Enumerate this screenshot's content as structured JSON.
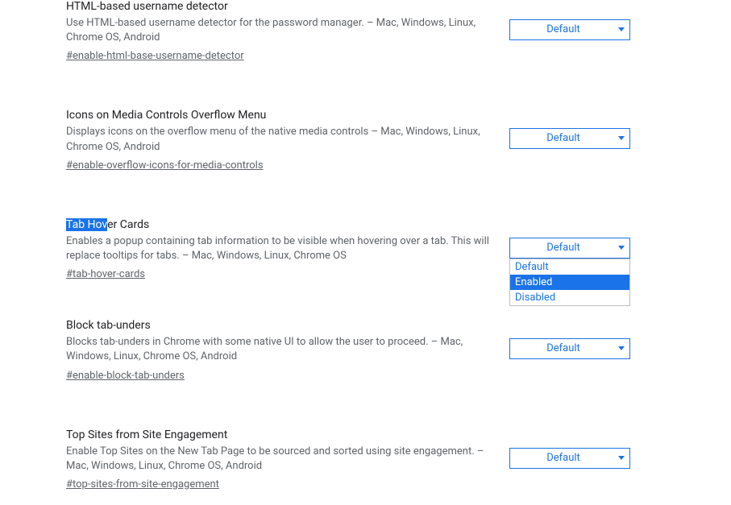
{
  "flags": [
    {
      "title": "HTML-based username detector",
      "desc": "Use HTML-based username detector for the password manager. – Mac, Windows, Linux, Chrome OS, Android",
      "hash": "#enable-html-base-username-detector",
      "highlight": null,
      "value": "Default",
      "open": false
    },
    {
      "title": "Icons on Media Controls Overflow Menu",
      "desc": "Displays icons on the overflow menu of the native media controls – Mac, Windows, Linux, Chrome OS, Android",
      "hash": "#enable-overflow-icons-for-media-controls",
      "highlight": null,
      "value": "Default",
      "open": false
    },
    {
      "title_hl": "Tab Hov",
      "title_rest": "er Cards",
      "desc": "Enables a popup containing tab information to be visible when hovering over a tab. This will replace tooltips for tabs. – Mac, Windows, Linux, Chrome OS",
      "hash": "#tab-hover-cards",
      "value": "Default",
      "open": true,
      "options": [
        "Default",
        "Enabled",
        "Disabled"
      ],
      "active_option": "Enabled"
    },
    {
      "title": "Block tab-unders",
      "desc": "Blocks tab-unders in Chrome with some native UI to allow the user to proceed. – Mac, Windows, Linux, Chrome OS, Android",
      "hash": "#enable-block-tab-unders",
      "highlight": null,
      "value": "Default",
      "open": false
    },
    {
      "title": "Top Sites from Site Engagement",
      "desc": "Enable Top Sites on the New Tab Page to be sourced and sorted using site engagement. – Mac, Windows, Linux, Chrome OS, Android",
      "hash": "#top-sites-from-site-engagement",
      "highlight": null,
      "value": "Default",
      "open": false
    }
  ]
}
